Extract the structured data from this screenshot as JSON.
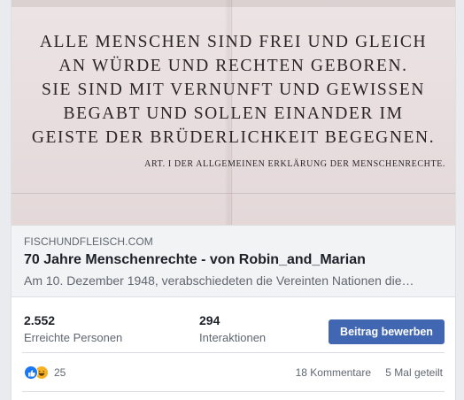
{
  "image": {
    "inscription_lines": [
      "ALLE MENSCHEN SIND FREI UND GLEICH",
      "AN WÜRDE UND RECHTEN GEBOREN.",
      "SIE SIND MIT VERNUNFT UND GEWISSEN",
      "BEGABT UND SOLLEN EINANDER IM",
      "GEISTE DER BRÜDERLICHKEIT BEGEGNEN."
    ],
    "caption": "ART. I DER ALLGEMEINEN ERKLÄRUNG DER MENSCHENRECHTE."
  },
  "link": {
    "domain": "FISCHUNDFLEISCH.COM",
    "title": "70 Jahre Menschenrechte - von Robin_and_Marian",
    "description": "Am 10. Dezember 1948, verabschiedeten die Vereinten Nationen die…"
  },
  "stats": {
    "reach_value": "2.552",
    "reach_label": "Erreichte Personen",
    "engagement_value": "294",
    "engagement_label": "Interaktionen",
    "boost_label": "Beitrag bewerben"
  },
  "reactions": {
    "icons": [
      "like-icon",
      "haha-icon"
    ],
    "count": "25",
    "comments": "18 Kommentare",
    "shares": "5 Mal geteilt"
  },
  "colors": {
    "accent": "#4267b2",
    "like": "#1877f2",
    "haha": "#f7b125",
    "link_box_bg": "#f2f3f5"
  }
}
